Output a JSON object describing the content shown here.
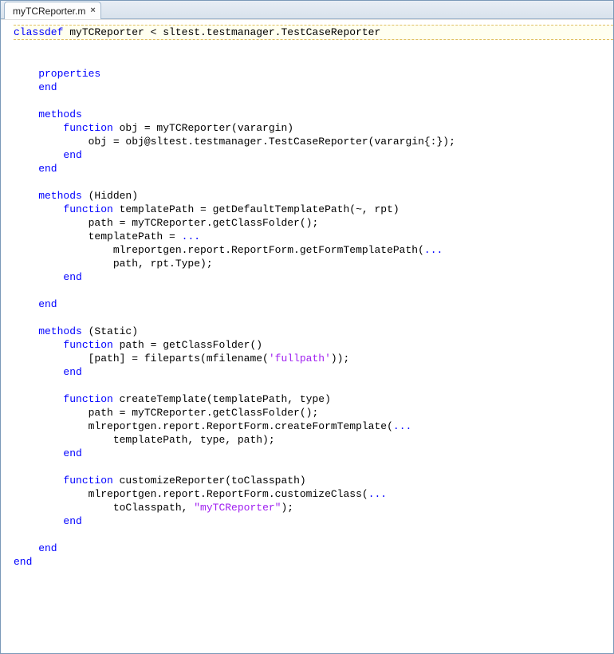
{
  "tab": {
    "filename": "myTCReporter.m",
    "close_glyph": "×"
  },
  "code": {
    "line1_pre": "classdef",
    "line1_rest": " myTCReporter < sltest.testmanager.TestCaseReporter",
    "l2": "",
    "l3a": "    properties",
    "l4a": "    end",
    "l5": "",
    "l6a": "    methods",
    "l7a": "        function",
    "l7b": " obj = myTCReporter(varargin)",
    "l8": "            obj = obj@sltest.testmanager.TestCaseReporter(varargin{:});",
    "l9a": "        end",
    "l10a": "    end",
    "l11": "",
    "l12a": "    methods",
    "l12b": " (Hidden)",
    "l13a": "        function",
    "l13b": " templatePath = getDefaultTemplatePath(~, rpt)",
    "l14": "            path = myTCReporter.getClassFolder();",
    "l15a": "            templatePath = ",
    "l15b": "...",
    "l16a": "                mlreportgen.report.ReportForm.getFormTemplatePath(",
    "l16b": "...",
    "l17": "                path, rpt.Type);",
    "l18a": "        end",
    "l19": "",
    "l20a": "    end",
    "l21": "",
    "l22a": "    methods",
    "l22b": " (Static)",
    "l23a": "        function",
    "l23b": " path = getClassFolder()",
    "l24a": "            [path] = fileparts(mfilename(",
    "l24b": "'fullpath'",
    "l24c": "));",
    "l25a": "        end",
    "l26": "",
    "l27a": "        function",
    "l27b": " createTemplate(templatePath, type)",
    "l28": "            path = myTCReporter.getClassFolder();",
    "l29a": "            mlreportgen.report.ReportForm.createFormTemplate(",
    "l29b": "...",
    "l30": "                templatePath, type, path);",
    "l31a": "        end",
    "l32": "",
    "l33a": "        function",
    "l33b": " customizeReporter(toClasspath)",
    "l34a": "            mlreportgen.report.ReportForm.customizeClass(",
    "l34b": "...",
    "l35a": "                toClasspath, ",
    "l35b": "\"myTCReporter\"",
    "l35c": ");",
    "l36a": "        end",
    "l37": "",
    "l38a": "    end",
    "l39a": "end"
  }
}
